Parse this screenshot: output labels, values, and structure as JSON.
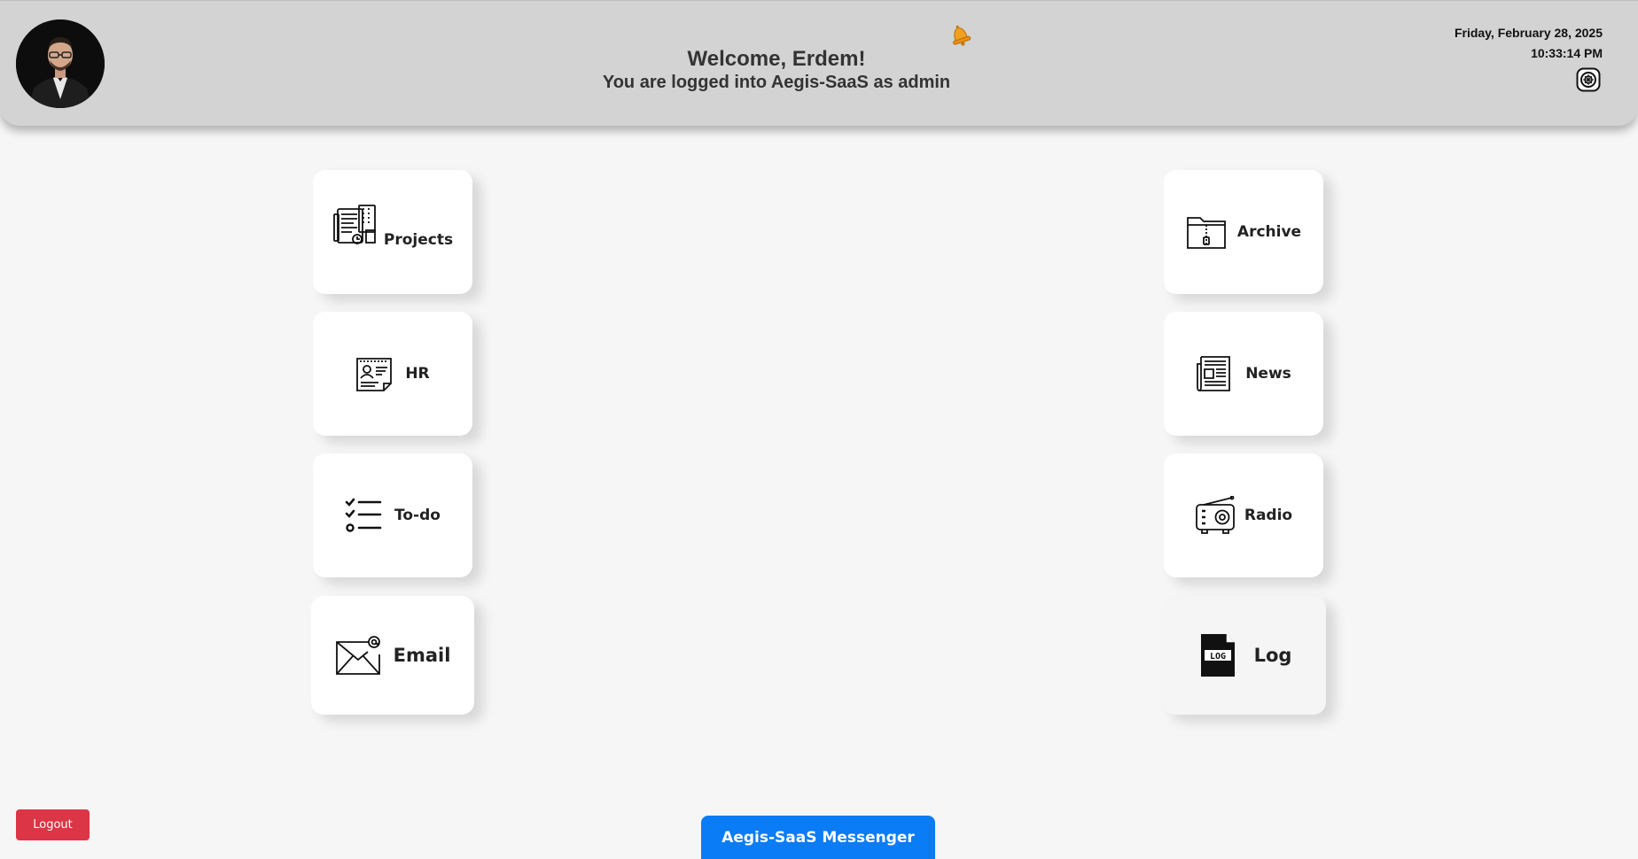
{
  "header": {
    "welcome": "Welcome, Erdem!",
    "subtitle": "You are logged into Aegis-SaaS as admin",
    "date": "Friday, February 28, 2025",
    "time": "10:33:14 PM",
    "avatar_icon": "user-avatar-photo",
    "bell_icon": "notification-bell-icon",
    "settings_icon": "settings-icon"
  },
  "tiles_left": [
    {
      "label": "Projects",
      "icon": "projects-icon"
    },
    {
      "label": "HR",
      "icon": "hr-id-card-icon"
    },
    {
      "label": "To-do",
      "icon": "checklist-icon"
    },
    {
      "label": "Email",
      "icon": "email-icon"
    }
  ],
  "tiles_right": [
    {
      "label": "Archive",
      "icon": "archive-folder-icon"
    },
    {
      "label": "News",
      "icon": "newspaper-icon"
    },
    {
      "label": "Radio",
      "icon": "radio-icon"
    },
    {
      "label": "Log",
      "icon": "log-file-icon",
      "icon_text": "LOG"
    }
  ],
  "footer": {
    "logout_label": "Logout",
    "messenger_label": "Aegis-SaaS Messenger"
  },
  "colors": {
    "header_bg": "#d3d3d3",
    "page_bg": "#f6f6f6",
    "logout_bg": "#dc3545",
    "messenger_bg": "#0a7cf5",
    "bell": "#f0a020"
  }
}
